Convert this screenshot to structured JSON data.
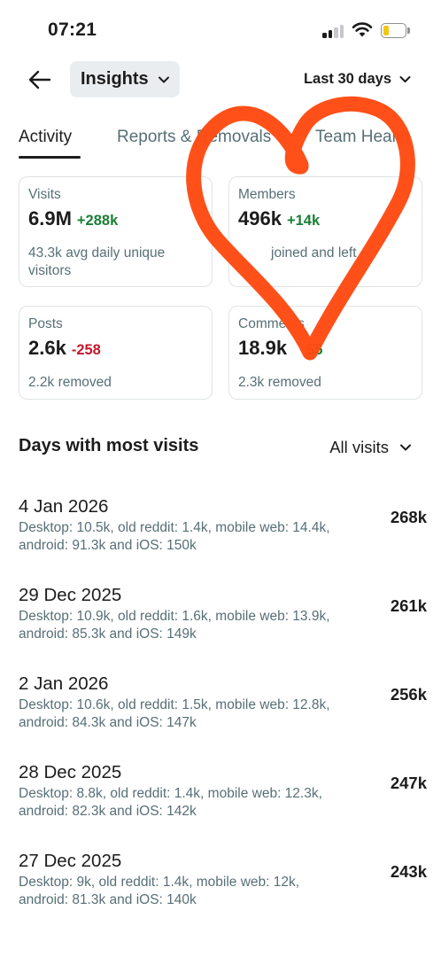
{
  "status_bar": {
    "time": "07:21"
  },
  "nav": {
    "title": "Insights",
    "period": "Last 30 days"
  },
  "tabs": [
    {
      "label": "Activity",
      "active": true
    },
    {
      "label": "Reports & Removals",
      "active": false
    },
    {
      "label": "Team Health",
      "active": false
    }
  ],
  "cards": [
    {
      "label": "Visits",
      "value": "6.9M",
      "delta": "+288k",
      "sub": "43.3k avg daily unique visitors"
    },
    {
      "label": "Members",
      "value": "496k",
      "delta": "+14k",
      "sub": "joined and left"
    },
    {
      "label": "Posts",
      "value": "2.6k",
      "delta": "-258",
      "sub": "2.2k removed"
    },
    {
      "label": "Comments",
      "value": "18.9k",
      "delta": "55",
      "sub": "2.3k removed"
    }
  ],
  "section": {
    "title": "Days with most visits",
    "filter": "All visits"
  },
  "days": [
    {
      "date": "4 Jan 2026",
      "detail": "Desktop: 10.5k, old reddit: 1.4k, mobile web: 14.4k, android: 91.3k and iOS: 150k",
      "total": "268k"
    },
    {
      "date": "29 Dec 2025",
      "detail": "Desktop: 10.9k, old reddit: 1.6k, mobile web: 13.9k, android: 85.3k and iOS: 149k",
      "total": "261k"
    },
    {
      "date": "2 Jan 2026",
      "detail": "Desktop: 10.6k, old reddit: 1.5k, mobile web: 12.8k, android: 84.3k and iOS: 147k",
      "total": "256k"
    },
    {
      "date": "28 Dec 2025",
      "detail": "Desktop: 8.8k, old reddit: 1.4k, mobile web: 12.3k, android: 82.3k and iOS: 142k",
      "total": "247k"
    },
    {
      "date": "27 Dec 2025",
      "detail": "Desktop: 9k, old reddit: 1.4k, mobile web: 12k, android: 81.3k and iOS: 140k",
      "total": "243k"
    }
  ],
  "colors": {
    "positive": "#1a7f37",
    "negative": "#c3192d",
    "muted_text": "#576f76",
    "scribble": "#ff4a12"
  },
  "icons": {
    "back": "arrow-left-icon",
    "dropdown": "chevron-down-icon",
    "signal": "cellular-signal-icon",
    "wifi": "wifi-icon",
    "battery": "battery-icon"
  }
}
